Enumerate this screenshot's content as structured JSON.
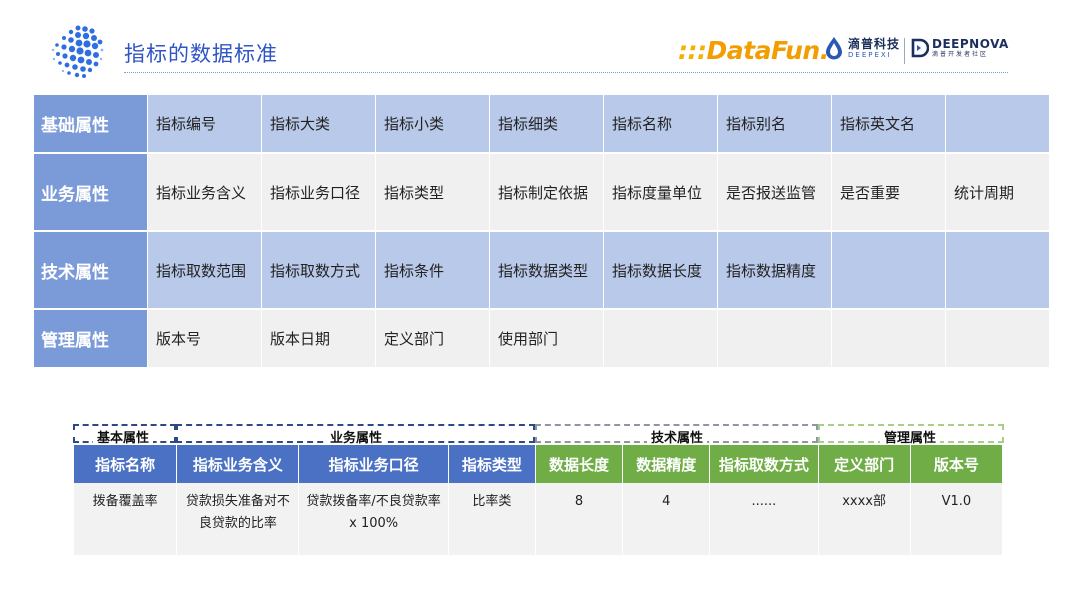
{
  "header": {
    "title": "指标的数据标准",
    "logo_datafun_prefix": ":::",
    "logo_datafun": "DataFun.",
    "logo_deepexi_cn": "滴普科技",
    "logo_deepexi_en": "DEEPEXI",
    "logo_deepnova_en": "DEEPNOVA",
    "logo_deepnova_cn": "滴普开发者社区"
  },
  "colors": {
    "title_blue": "#2f55c6",
    "row_head_blue": "#7b9ad8",
    "light_blue": "#b9c9ea",
    "header_blue": "#4a71c4",
    "header_green": "#70ad47",
    "datafun_orange": "#f29d00"
  },
  "attributes": {
    "rows": [
      {
        "head": "基础属性",
        "cells": [
          "指标编号",
          "指标大类",
          "指标小类",
          "指标细类",
          "指标名称",
          "指标别名",
          "指标英文名",
          ""
        ]
      },
      {
        "head": "业务属性",
        "cells": [
          "指标业务含义",
          "指标业务口径",
          "指标类型",
          "指标制定依据",
          "指标度量单位",
          "是否报送监管",
          "是否重要",
          "统计周期"
        ]
      },
      {
        "head": "技术属性",
        "cells": [
          "指标取数范围",
          "指标取数方式",
          "指标条件",
          "指标数据类型",
          "指标数据长度",
          "指标数据精度",
          "",
          ""
        ]
      },
      {
        "head": "管理属性",
        "cells": [
          "版本号",
          "版本日期",
          "定义部门",
          "使用部门",
          "",
          "",
          "",
          ""
        ]
      }
    ]
  },
  "example": {
    "groups": {
      "basic": "基本属性",
      "business": "业务属性",
      "tech": "技术属性",
      "mgmt": "管理属性"
    },
    "headers": [
      "指标名称",
      "指标业务含义",
      "指标业务口径",
      "指标类型",
      "数据长度",
      "数据精度",
      "指标取数方式",
      "定义部门",
      "版本号"
    ],
    "row": [
      "拨备覆盖率",
      "贷款损失准备对不良贷款的比率",
      "贷款拨备率/不良贷款率 x 100%",
      "比率类",
      "8",
      "4",
      "......",
      "xxxx部",
      "V1.0"
    ]
  }
}
